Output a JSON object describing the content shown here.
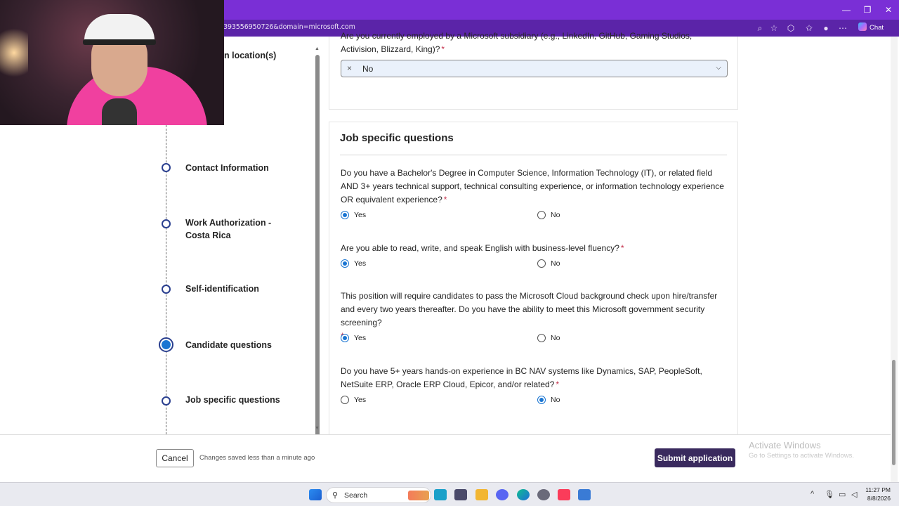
{
  "browser": {
    "url": "393556950726&domain=microsoft.com",
    "chat_label": "Chat",
    "window_controls": {
      "minimize": "—",
      "restore": "❐",
      "close": "✕"
    }
  },
  "nav": {
    "partial_item": "n location(s)",
    "steps": [
      {
        "label": "Contact Information",
        "state": "pending"
      },
      {
        "label": "Work Authorization -\nCosta Rica",
        "state": "pending"
      },
      {
        "label": "Self-identification",
        "state": "pending"
      },
      {
        "label": "Candidate questions",
        "state": "active"
      },
      {
        "label": "Job specific questions",
        "state": "pending"
      }
    ]
  },
  "prev_question": {
    "text": "Are you currently employed by a Microsoft subsidiary (e.g., LinkedIn, GitHub, Gaming Studios, Activision, Blizzard, King)?",
    "required_mark": "*",
    "select_value": "No",
    "clear_icon": "×",
    "chevron_icon": "⌄"
  },
  "section": {
    "title": "Job specific questions",
    "questions": [
      {
        "text": "Do you have a Bachelor's Degree in Computer Science, Information Technology (IT), or related field AND 3+ years technical support, technical consulting experience, or information technology experience OR equivalent experience?",
        "required_mark": "*",
        "options": [
          "Yes",
          "No"
        ],
        "selected": "Yes"
      },
      {
        "text": "Are you able to read, write, and speak English with business-level fluency?",
        "required_mark": "*",
        "options": [
          "Yes",
          "No"
        ],
        "selected": "Yes"
      },
      {
        "text": "This position will require candidates to pass the Microsoft Cloud background check upon hire/transfer and every two years thereafter. Do you have the ability to meet this Microsoft government security screening?",
        "required_mark": "*",
        "options": [
          "Yes",
          "No"
        ],
        "selected": "Yes"
      },
      {
        "text": "Do you have 5+ years hands-on experience in BC NAV systems like Dynamics, SAP, PeopleSoft, NetSuite ERP, Oracle ERP Cloud, Epicor, and/or related?",
        "required_mark": "*",
        "options": [
          "Yes",
          "No"
        ],
        "selected": "No"
      }
    ]
  },
  "footer": {
    "cancel_label": "Cancel",
    "saved_status": "Changes saved less than a minute ago",
    "submit_label": "Submit application",
    "submit_color": "#3a2a5e"
  },
  "watermark": {
    "line1": "Activate Windows",
    "line2": "Go to Settings to activate Windows."
  },
  "taskbar": {
    "search_label": "Search",
    "time": "11:27 PM",
    "date": "8/8/2026"
  },
  "colors": {
    "accent": "#1a75d2",
    "browser_frame": "#7a2fd6",
    "step_ring": "#2a3f8f"
  }
}
